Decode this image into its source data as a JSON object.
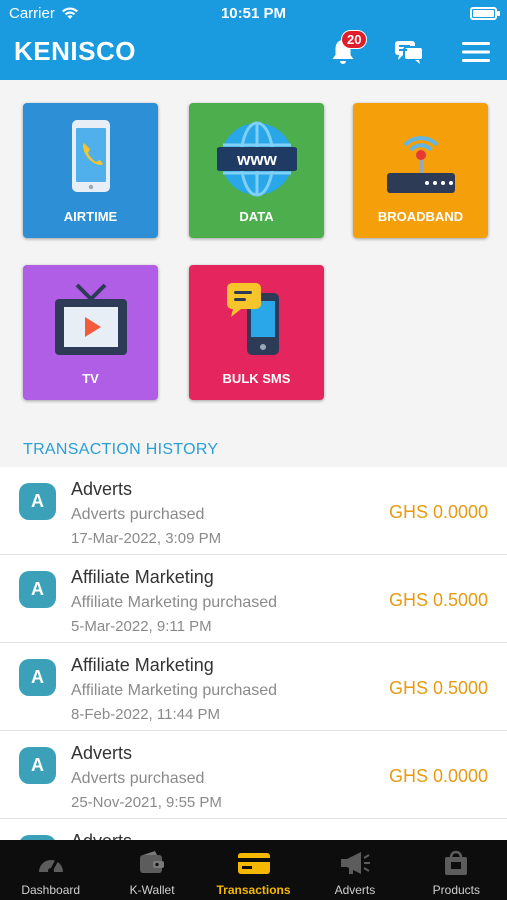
{
  "status_bar": {
    "carrier": "Carrier",
    "time": "10:51 PM"
  },
  "header": {
    "brand": "KENISCO",
    "notification_count": "20"
  },
  "services": [
    {
      "label": "AIRTIME",
      "color": "#2d8fd6"
    },
    {
      "label": "DATA",
      "color": "#4cae4c"
    },
    {
      "label": "BROADBAND",
      "color": "#f5a00a"
    },
    {
      "label": "TV",
      "color": "#b05ee6"
    },
    {
      "label": "BULK SMS",
      "color": "#e5265e"
    }
  ],
  "transactions_section": {
    "title": "TRANSACTION HISTORY"
  },
  "transactions": [
    {
      "initial": "A",
      "title": "Adverts",
      "description": "Adverts purchased",
      "date": "17-Mar-2022, 3:09 PM",
      "amount": "GHS 0.0000"
    },
    {
      "initial": "A",
      "title": "Affiliate Marketing",
      "description": "Affiliate Marketing purchased",
      "date": "5-Mar-2022, 9:11 PM",
      "amount": "GHS 0.5000"
    },
    {
      "initial": "A",
      "title": "Affiliate Marketing",
      "description": "Affiliate Marketing purchased",
      "date": "8-Feb-2022, 11:44 PM",
      "amount": "GHS 0.5000"
    },
    {
      "initial": "A",
      "title": "Adverts",
      "description": "Adverts purchased",
      "date": "25-Nov-2021, 9:55 PM",
      "amount": "GHS 0.0000"
    },
    {
      "initial": "A",
      "title": "Adverts",
      "description": "",
      "date": "",
      "amount": ""
    }
  ],
  "bottom_nav": [
    {
      "label": "Dashboard",
      "icon": "gauge-icon"
    },
    {
      "label": "K-Wallet",
      "icon": "wallet-icon"
    },
    {
      "label": "Transactions",
      "icon": "card-icon",
      "active": true
    },
    {
      "label": "Adverts",
      "icon": "megaphone-icon"
    },
    {
      "label": "Products",
      "icon": "shopping-bag-icon"
    }
  ],
  "colors": {
    "header": "#1a9be0",
    "accent_amount": "#e59b12",
    "nav_active": "#f5b800",
    "section_title": "#2a9fd6"
  }
}
